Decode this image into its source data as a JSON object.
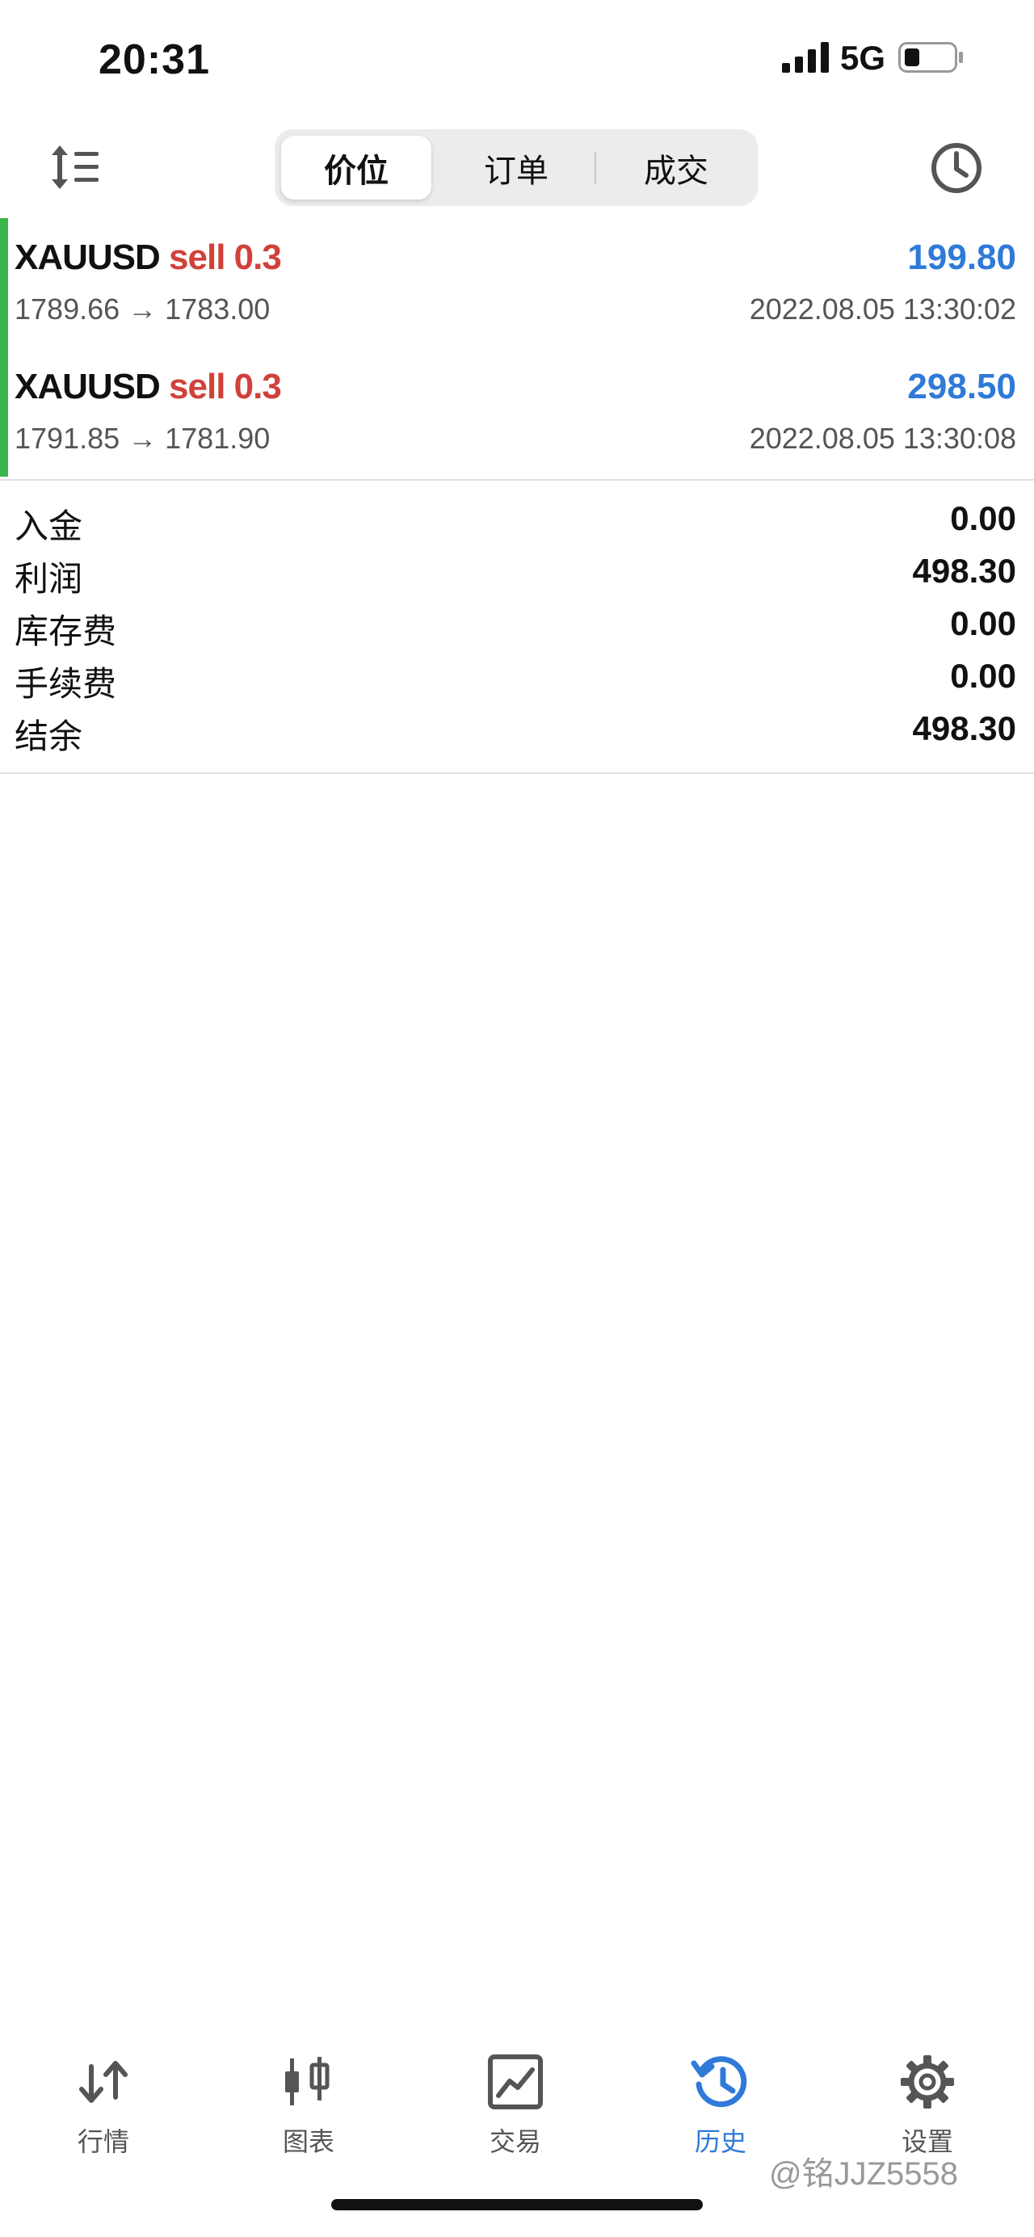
{
  "status_bar": {
    "time": "20:31",
    "network": "5G"
  },
  "toolbar": {
    "segments": [
      {
        "label": "价位",
        "active": true
      },
      {
        "label": "订单",
        "active": false
      },
      {
        "label": "成交",
        "active": false
      }
    ]
  },
  "trades": [
    {
      "symbol": "XAUUSD",
      "side": "sell 0.3",
      "prices": "1789.66 → 1783.00",
      "timestamp": "2022.08.05 13:30:02",
      "profit": "199.80"
    },
    {
      "symbol": "XAUUSD",
      "side": "sell 0.3",
      "prices": "1791.85 → 1781.90",
      "timestamp": "2022.08.05 13:30:08",
      "profit": "298.50"
    }
  ],
  "summary": [
    {
      "label": "入金",
      "value": "0.00"
    },
    {
      "label": "利润",
      "value": "498.30"
    },
    {
      "label": "库存费",
      "value": "0.00"
    },
    {
      "label": "手续费",
      "value": "0.00"
    },
    {
      "label": "结余",
      "value": "498.30"
    }
  ],
  "tabbar": {
    "tabs": [
      {
        "label": "行情",
        "icon": "quotes-arrows-icon"
      },
      {
        "label": "图表",
        "icon": "candlestick-chart-icon"
      },
      {
        "label": "交易",
        "icon": "trade-chart-icon"
      },
      {
        "label": "历史",
        "icon": "history-clock-icon",
        "active": true
      },
      {
        "label": "设置",
        "icon": "gear-icon"
      }
    ]
  },
  "watermark": "@铭JJZ5558",
  "colors": {
    "accent_blue": "#2f7ad8",
    "sell_red": "#d0413a",
    "position_green": "#3bb54a"
  }
}
